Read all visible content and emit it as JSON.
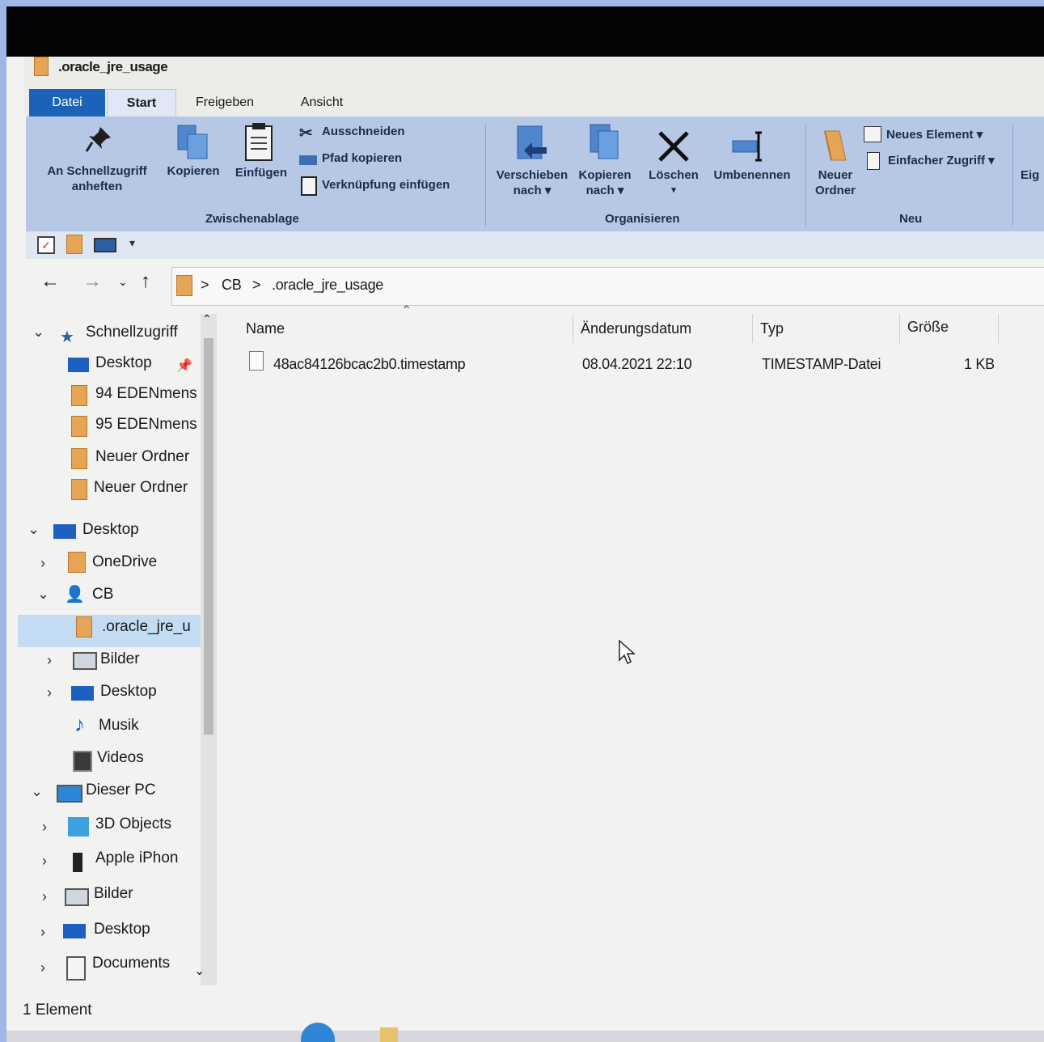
{
  "window": {
    "title": ".oracle_jre_usage"
  },
  "tabs": [
    {
      "label": "Datei"
    },
    {
      "label": "Start"
    },
    {
      "label": "Freigeben"
    },
    {
      "label": "Ansicht"
    }
  ],
  "ribbon": {
    "clipboard": {
      "pin_label_1": "An Schnellzugriff",
      "pin_label_2": "anheften",
      "copy_label": "Kopieren",
      "paste_label": "Einfügen",
      "cut_label": "Ausschneiden",
      "copy_path_label": "Pfad kopieren",
      "paste_shortcut_label": "Verknüpfung einfügen",
      "group_label": "Zwischenablage"
    },
    "organize": {
      "move_label_1": "Verschieben",
      "move_label_2": "nach ▾",
      "copyto_label_1": "Kopieren",
      "copyto_label_2": "nach ▾",
      "delete_label": "Löschen",
      "delete_arrow": "▾",
      "rename_label": "Umbenennen",
      "group_label": "Organisieren"
    },
    "new": {
      "new_folder_label_1": "Neuer",
      "new_folder_label_2": "Ordner",
      "new_item_label": "Neues Element ▾",
      "easy_access_label": "Einfacher Zugriff ▾",
      "group_label": "Neu"
    },
    "open": {
      "properties_label_partial": "Eig"
    }
  },
  "address": {
    "path": [
      "CB",
      ".oracle_jre_usage"
    ],
    "separator": ">"
  },
  "nav": {
    "quick_access": "Schnellzugriff",
    "items": [
      {
        "label": "Desktop"
      },
      {
        "label": "94  EDENmens"
      },
      {
        "label": "95  EDENmens"
      },
      {
        "label": "Neuer Ordner"
      },
      {
        "label": "Neuer Ordner"
      },
      {
        "label": "Desktop"
      },
      {
        "label": "OneDrive"
      },
      {
        "label": "CB"
      },
      {
        "label": ".oracle_jre_u"
      },
      {
        "label": "Bilder"
      },
      {
        "label": "Desktop"
      },
      {
        "label": "Musik"
      },
      {
        "label": "Videos"
      },
      {
        "label": "Dieser PC"
      },
      {
        "label": "3D Objects"
      },
      {
        "label": "Apple iPhon"
      },
      {
        "label": "Bilder"
      },
      {
        "label": "Desktop"
      },
      {
        "label": "Documents"
      }
    ]
  },
  "columns": {
    "name": "Name",
    "date": "Änderungsdatum",
    "type": "Typ",
    "size": "Größe"
  },
  "files": [
    {
      "name": "48ac84126bcac2b0.timestamp",
      "date": "08.04.2021 22:10",
      "type": "TIMESTAMP-Datei",
      "size": "1 KB"
    }
  ],
  "status": {
    "count": "1 Element"
  },
  "colors": {
    "ribbon": "#b6c8e6",
    "datei_tab": "#1c62b8",
    "selection": "#c3dcf4",
    "folder": "#e6a456"
  }
}
